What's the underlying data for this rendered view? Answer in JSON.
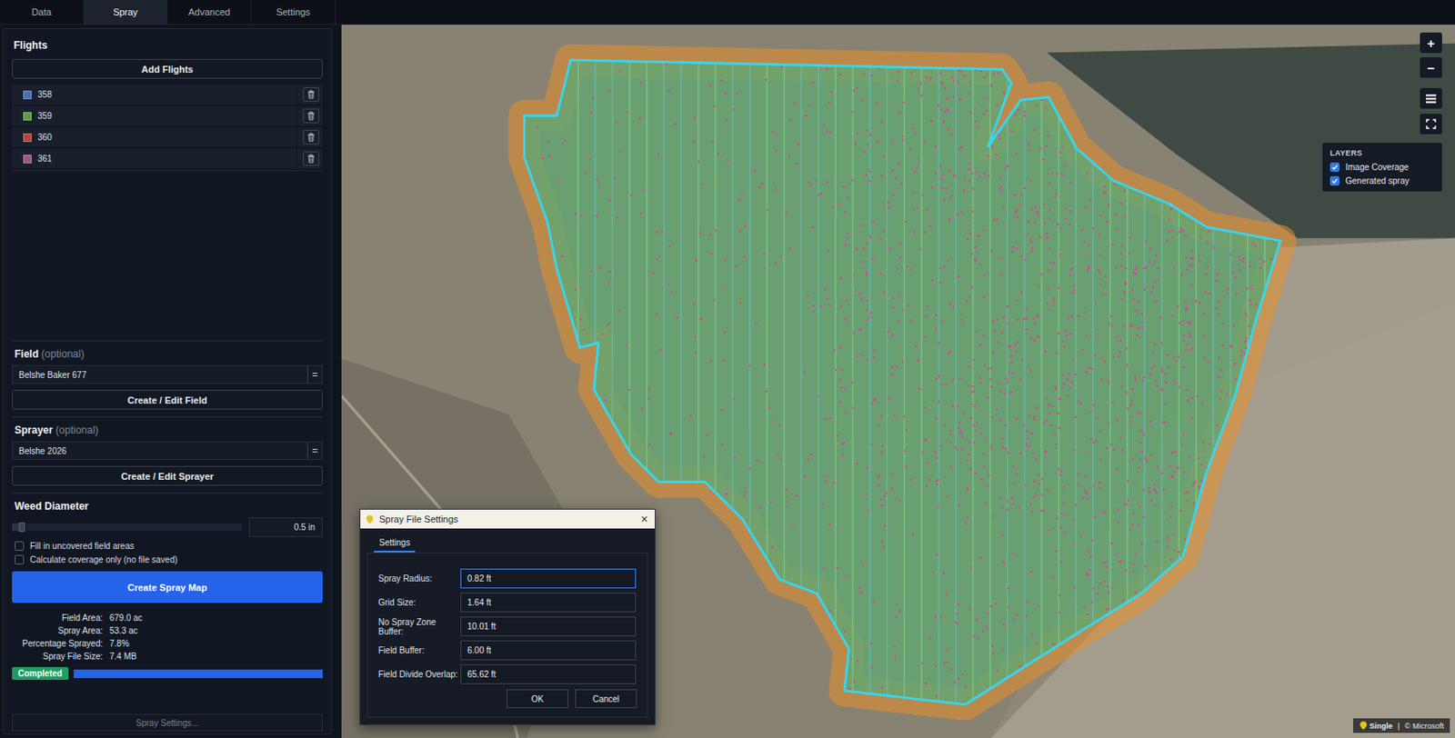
{
  "tabs": [
    {
      "label": "Data",
      "selected": false
    },
    {
      "label": "Spray",
      "selected": true
    },
    {
      "label": "Advanced",
      "selected": false
    },
    {
      "label": "Settings",
      "selected": false
    }
  ],
  "flights": {
    "title": "Flights",
    "add_button": "Add Flights",
    "items": [
      {
        "name": "358",
        "color": "#4a70b2"
      },
      {
        "name": "359",
        "color": "#5e9a48"
      },
      {
        "name": "360",
        "color": "#b3443f"
      },
      {
        "name": "361",
        "color": "#975a84"
      }
    ]
  },
  "field": {
    "label": "Field",
    "optional": "(optional)",
    "value": "Belshe Baker 677",
    "menu_glyph": "=",
    "button": "Create / Edit Field"
  },
  "sprayer": {
    "label": "Sprayer",
    "optional": "(optional)",
    "value": "Belshe 2026",
    "menu_glyph": "=",
    "button": "Create / Edit Sprayer"
  },
  "weed_diameter": {
    "label": "Weed Diameter",
    "level": 0.04,
    "value": "0.5 in"
  },
  "options": [
    {
      "label": "Fill in uncovered field areas",
      "checked": false
    },
    {
      "label": "Calculate coverage only (no file saved)",
      "checked": false
    }
  ],
  "create_button": "Create Spray Map",
  "stats": [
    {
      "label": "Field Area:",
      "value": "679.0 ac"
    },
    {
      "label": "Spray Area:",
      "value": "53.3 ac"
    },
    {
      "label": "Percentage Sprayed:",
      "value": "7.8%"
    },
    {
      "label": "Spray File Size:",
      "value": "7.4 MB"
    }
  ],
  "status": {
    "badge": "Completed",
    "level": 1
  },
  "spray_settings_button": {
    "label": "Spray Settings...",
    "disabled": true
  },
  "map": {
    "zoom_in": "+",
    "zoom_out": "−",
    "layers": {
      "title": "LAYERS",
      "items": [
        {
          "label": "Image Coverage",
          "checked": true
        },
        {
          "label": "Generated spray",
          "checked": true
        }
      ]
    },
    "attribution": {
      "brand": "Single",
      "separator": "|",
      "copyright": "© Microsoft"
    }
  },
  "dialog": {
    "title": "Spray File Settings",
    "close": "×",
    "tabs": [
      {
        "label": "Settings",
        "selected": true
      }
    ],
    "fields": [
      {
        "label": "Spray Radius:",
        "value": "0.82 ft",
        "focused": true
      },
      {
        "label": "Grid Size:",
        "value": "1.64 ft",
        "focused": false
      },
      {
        "label": "No Spray Zone Buffer:",
        "value": "10.01 ft",
        "focused": false
      },
      {
        "label": "Field Buffer:",
        "value": "6.00 ft",
        "focused": false
      },
      {
        "label": "Field Divide Overlap:",
        "value": "65.62 ft",
        "focused": false
      }
    ],
    "buttons": [
      "OK",
      "Cancel"
    ]
  }
}
